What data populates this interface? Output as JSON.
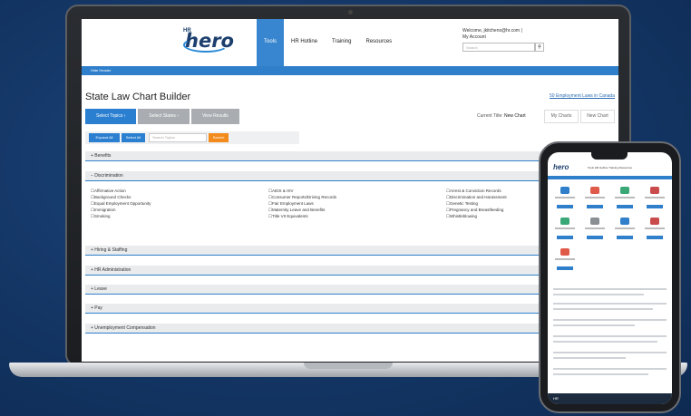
{
  "laptop": {
    "header": {
      "logo_small": "HR",
      "logo_text": "hero",
      "nav": [
        "Tools",
        "HR Hotline",
        "Training",
        "Resources"
      ],
      "welcome": "Welcome, jkitchens@hr.com |",
      "account": "My Account",
      "search_placeholder": "Search",
      "search_icon": "search-icon"
    },
    "hide_header": "Hide Header",
    "page_title": "State Law Chart Builder",
    "canada_link": "50 Employment Laws in Canada",
    "steps": [
      "Select Topics ›",
      "Select States ›",
      "View Results"
    ],
    "current_label": "Current Title:",
    "current_value": "New Chart",
    "tabs": [
      "My Charts",
      "New Chart"
    ],
    "toolbar": {
      "expand_all": "Expand All",
      "select_all": "Select All",
      "search_placeholder": "Search Topics",
      "search_btn": "Search"
    },
    "sections": [
      "+ Benefits",
      "− Discrimination",
      "+ Hiring & Staffing",
      "+ HR Administration",
      "+ Leave",
      "+ Pay",
      "+ Unemployment Compensation"
    ],
    "discrimination_items": {
      "col1": [
        "Affirmative Action",
        "Background Checks",
        "Equal Employment Opportunity",
        "Immigration",
        "Smoking"
      ],
      "col2": [
        "AIDS & HIV",
        "Consumer Reports/Driving Records",
        "Fair Employment Laws",
        "Maternity Leave and Benefits",
        "Title VII Equivalents"
      ],
      "col3": [
        "Arrest & Conviction Records",
        "Discrimination and Harassment",
        "Genetic Testing",
        "Pregnancy and Breastfeeding",
        "Whistleblowing"
      ]
    }
  },
  "phone": {
    "logo_text": "hero",
    "nav": "Tools  HR Hotline  Training  Resources",
    "footer": "HR"
  },
  "colors": {
    "background": "#15396a",
    "accent_blue": "#2f7fcb",
    "search_orange": "#f28a1c",
    "step_inactive": "#a9adb1"
  }
}
